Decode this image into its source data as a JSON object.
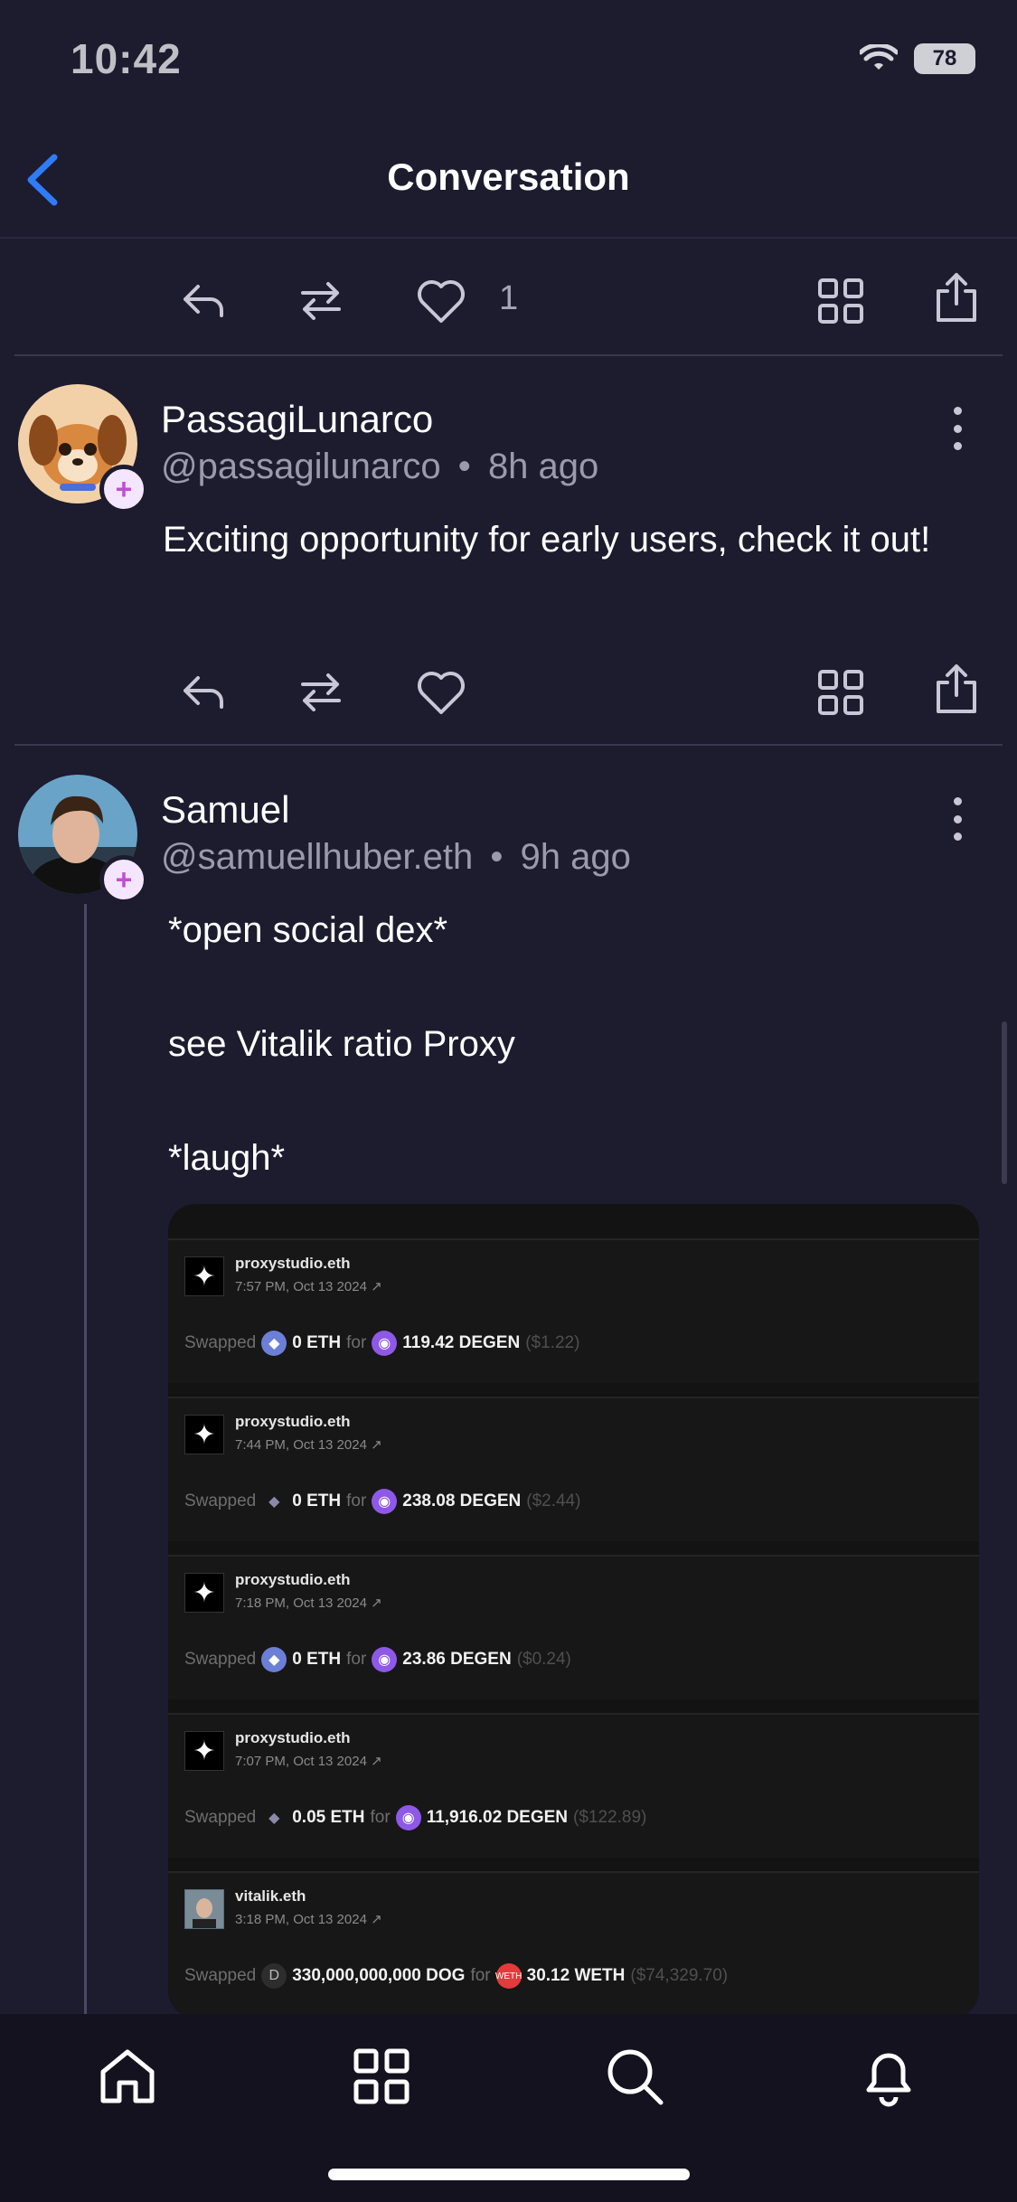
{
  "status": {
    "time": "10:42",
    "battery": "78"
  },
  "header": {
    "title": "Conversation"
  },
  "top_actions": {
    "like_count": "1"
  },
  "posts": [
    {
      "display_name": "PassagiLunarco",
      "handle": "@passagilunarco",
      "age": "8h ago",
      "text": "Exciting opportunity for early users, check it out!"
    },
    {
      "display_name": "Samuel",
      "handle": "@samuellhuber.eth",
      "age": "9h ago",
      "lines": [
        "*open social dex*",
        "see Vitalik ratio Proxy",
        "*laugh*"
      ]
    }
  ],
  "separator": "•",
  "embed": {
    "cards": [
      {
        "account": "proxystudio.eth",
        "time": "7:57 PM, Oct 13 2024 ↗",
        "verb": "Swapped",
        "amount_in": "0 ETH",
        "for_word": "for",
        "amount_out": "119.42 DEGEN",
        "usd": "($1.22)"
      },
      {
        "account": "proxystudio.eth",
        "time": "7:44 PM, Oct 13 2024 ↗",
        "verb": "Swapped",
        "amount_in": "0 ETH",
        "for_word": "for",
        "amount_out": "238.08 DEGEN",
        "usd": "($2.44)"
      },
      {
        "account": "proxystudio.eth",
        "time": "7:18 PM, Oct 13 2024 ↗",
        "verb": "Swapped",
        "amount_in": "0 ETH",
        "for_word": "for",
        "amount_out": "23.86 DEGEN",
        "usd": "($0.24)"
      },
      {
        "account": "proxystudio.eth",
        "time": "7:07 PM, Oct 13 2024 ↗",
        "verb": "Swapped",
        "amount_in": "0.05 ETH",
        "for_word": "for",
        "amount_out": "11,916.02 DEGEN",
        "usd": "($122.89)"
      },
      {
        "account": "vitalik.eth",
        "time": "3:18 PM, Oct 13 2024 ↗",
        "verb": "Swapped",
        "amount_in": "330,000,000,000 DOG",
        "for_word": "for",
        "amount_out": "30.12 WETH",
        "usd": "($74,329.70)"
      }
    ],
    "dog_letter": "D",
    "weth_label": "WETH"
  },
  "icons": {
    "back": "chevron-left-icon",
    "reply": "reply-icon",
    "recast": "recast-icon",
    "like": "heart-icon",
    "channels": "grid-icon",
    "share": "share-icon",
    "more": "more-icon",
    "home": "home-icon",
    "explore": "grid-icon",
    "search": "search-icon",
    "notifications": "bell-icon"
  },
  "colors": {
    "background": "#1d1b2e",
    "accent": "#2f7cf6",
    "plus_badge": "#c04fd6"
  }
}
